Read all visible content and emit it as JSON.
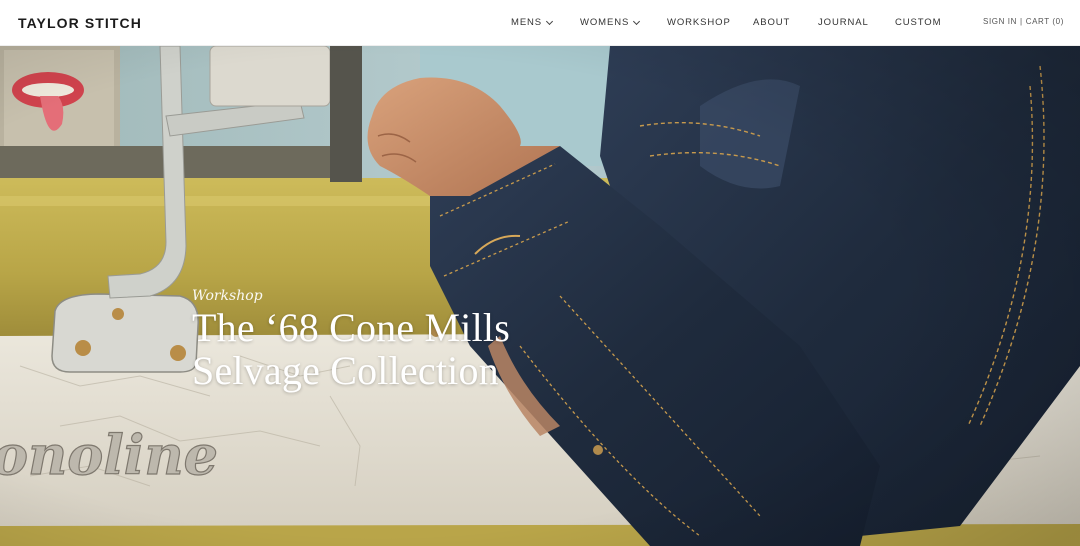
{
  "brand": {
    "name": "TAYLOR STITCH"
  },
  "nav": {
    "items": [
      {
        "label": "MENS",
        "has_dropdown": true
      },
      {
        "label": "WOMENS",
        "has_dropdown": true
      },
      {
        "label": "WORKSHOP",
        "has_dropdown": false
      },
      {
        "label": "ABOUT",
        "has_dropdown": false
      },
      {
        "label": "JOURNAL",
        "has_dropdown": false
      },
      {
        "label": "CUSTOM",
        "has_dropdown": false
      }
    ]
  },
  "account": {
    "sign_in": "SIGN IN",
    "separator": "|",
    "cart": "CART (0)"
  },
  "hero": {
    "eyebrow": "Workshop",
    "title_line1": "The ‘68 Cone Mills",
    "title_line2": "Selvage Collection",
    "car_badge": "onoline"
  },
  "colors": {
    "header_bg": "#ffffff",
    "mustard": "#c6b24f",
    "denim": "#243247",
    "cream": "#e6e1d6"
  }
}
